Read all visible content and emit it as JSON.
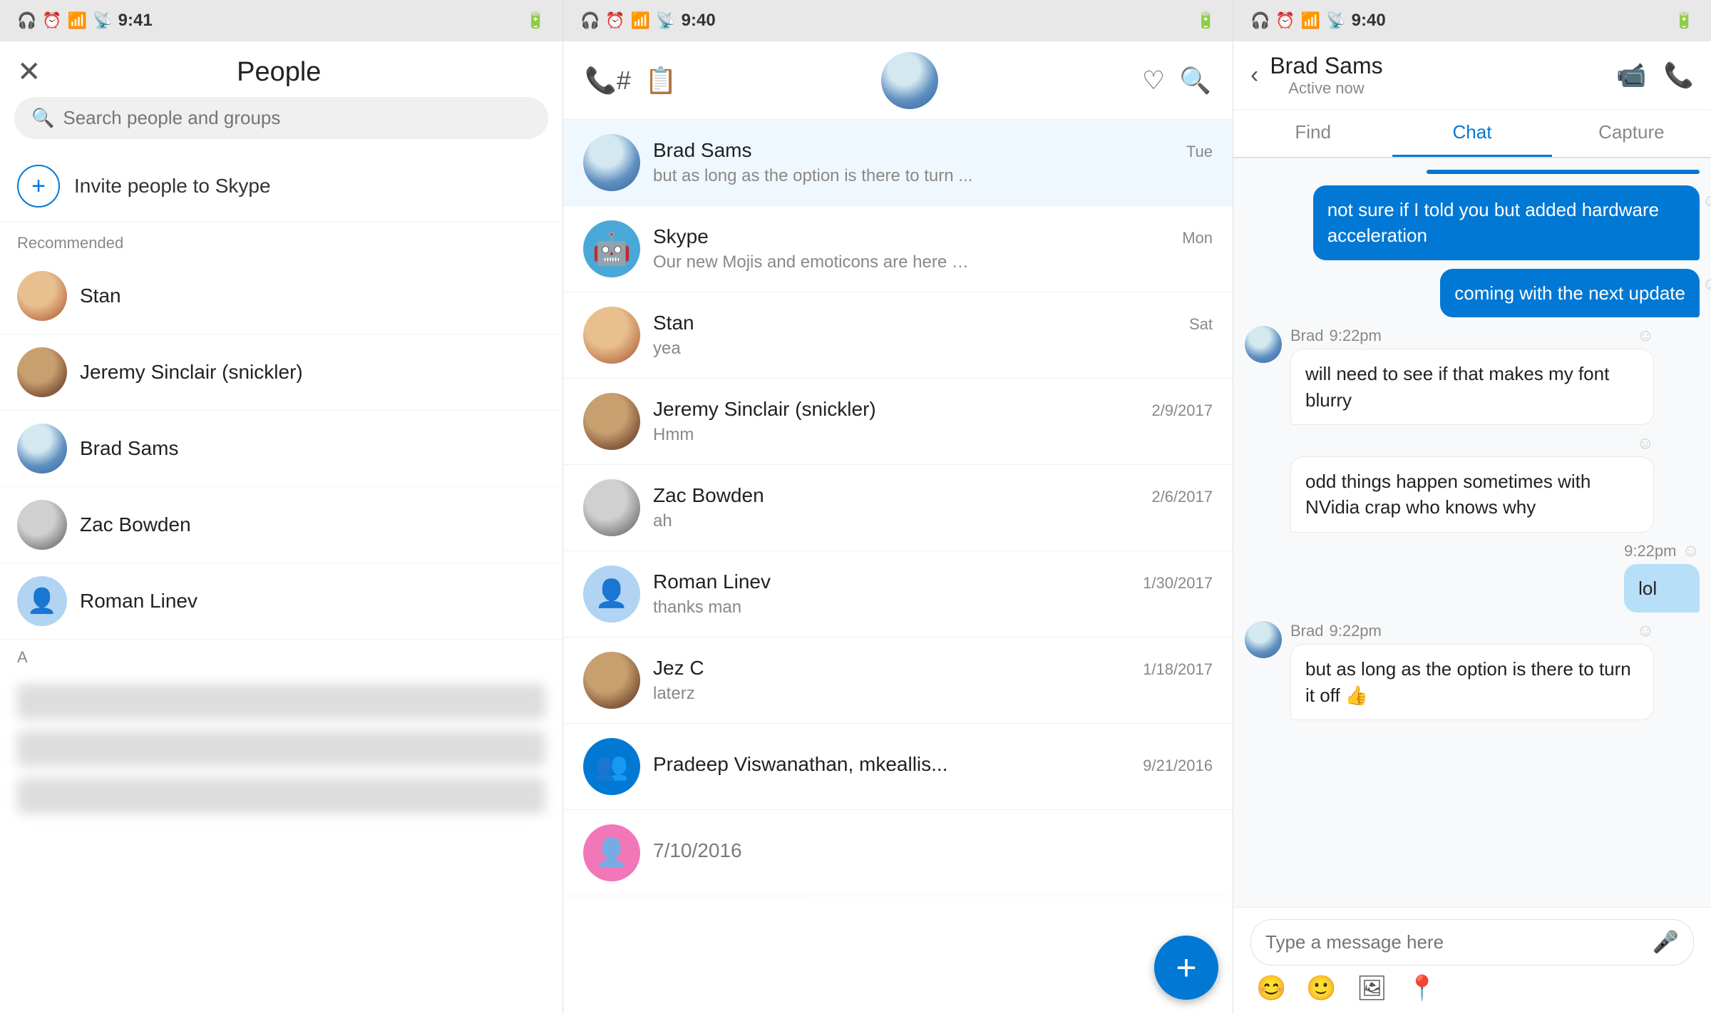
{
  "app": {
    "title": "Skype"
  },
  "statusbars": {
    "left": {
      "time": "9:41",
      "icons": [
        "headphone",
        "alarm",
        "wifi",
        "signal",
        "battery"
      ]
    },
    "middle": {
      "time": "9:40",
      "icons": [
        "headphone",
        "alarm",
        "wifi",
        "signal",
        "battery"
      ]
    },
    "right": {
      "time": "9:40",
      "icons": [
        "headphone",
        "alarm",
        "wifi",
        "signal",
        "battery"
      ]
    }
  },
  "left_panel": {
    "title": "People",
    "search_placeholder": "Search people and groups",
    "invite_label": "Invite people to Skype",
    "recommended_label": "Recommended",
    "contacts": [
      {
        "name": "Stan",
        "avatar_class": "av-stan"
      },
      {
        "name": "Jeremy Sinclair (snickler)",
        "avatar_class": "av-jeremy"
      },
      {
        "name": "Brad Sams",
        "avatar_class": "av-brad-people"
      },
      {
        "name": "Zac Bowden",
        "avatar_class": "av-zac"
      },
      {
        "name": "Roman Linev",
        "avatar_class": "av-roman placeholder"
      }
    ],
    "section_label": "A"
  },
  "middle_panel": {
    "conversations": [
      {
        "name": "Brad Sams",
        "time": "Tue",
        "preview": "but as long as the option is there to turn ...",
        "avatar_class": "av-brad-people"
      },
      {
        "name": "Skype",
        "time": "Mon",
        "preview": "Our new Mojis and emoticons are here …",
        "avatar_class": "robot",
        "is_robot": true
      },
      {
        "name": "Stan",
        "time": "Sat",
        "preview": "yea",
        "avatar_class": "av-stan"
      },
      {
        "name": "Jeremy Sinclair (snickler)",
        "time": "2/9/2017",
        "preview": "Hmm",
        "avatar_class": "av-jeremy"
      },
      {
        "name": "Zac Bowden",
        "time": "2/6/2017",
        "preview": "ah",
        "avatar_class": "av-zac"
      },
      {
        "name": "Roman Linev",
        "time": "1/30/2017",
        "preview": "thanks man",
        "avatar_class": "av-roman placeholder"
      },
      {
        "name": "Jez C",
        "time": "1/18/2017",
        "preview": "laterz",
        "avatar_class": "av-jeremy"
      },
      {
        "name": "Pradeep Viswanathan, mkeallis...",
        "time": "9/21/2016",
        "preview": "",
        "avatar_class": "group",
        "is_group": true
      },
      {
        "name": "...",
        "time": "7/10/2016",
        "preview": "",
        "avatar_class": "pink",
        "is_pink": true
      }
    ],
    "fab_label": "+"
  },
  "right_panel": {
    "user_name": "Brad Sams",
    "user_status": "Active now",
    "tabs": [
      "Find",
      "Chat",
      "Capture"
    ],
    "active_tab": "Chat",
    "messages": [
      {
        "type": "sent",
        "text": "not sure if I told you but added hardware acceleration",
        "has_emoji_react": true
      },
      {
        "type": "sent",
        "text": "coming with the next update",
        "has_emoji_react": true
      },
      {
        "type": "received",
        "sender": "Brad",
        "time": "9:22pm",
        "text": "will need to see if that makes my font blurry",
        "has_emoji_react": true
      },
      {
        "type": "received",
        "sender": "",
        "time": "",
        "text": "odd things happen sometimes with NVidia crap who knows why",
        "has_emoji_react": true
      },
      {
        "type": "sent",
        "time": "9:22pm",
        "text": "lol",
        "has_emoji_react": true
      },
      {
        "type": "received",
        "sender": "Brad",
        "time": "9:22pm",
        "text": "but as long as the option is there to turn it off 👍",
        "has_emoji_react": true
      }
    ],
    "input_placeholder": "Type a message here",
    "toolbar_icons": [
      "emoji",
      "sticker",
      "image",
      "location"
    ]
  }
}
